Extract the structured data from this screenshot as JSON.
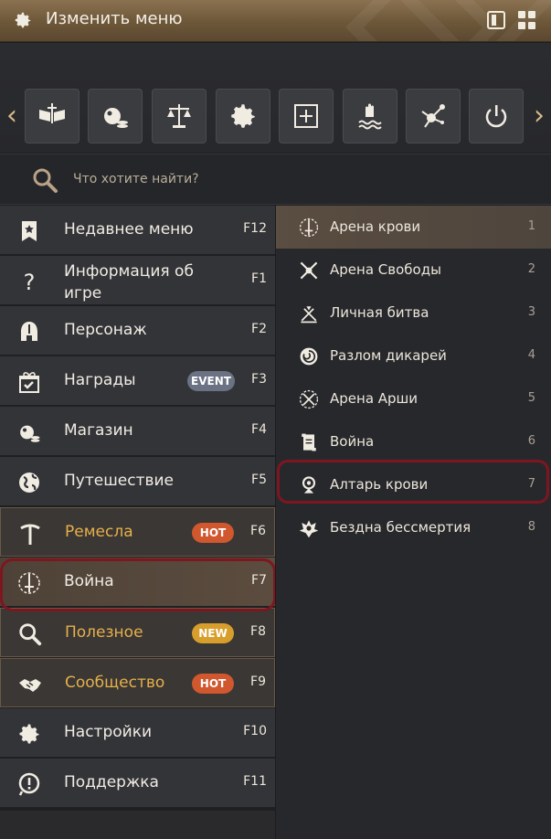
{
  "window": {
    "title": "Изменить меню"
  },
  "search": {
    "placeholder": "Что хотите найти?"
  },
  "menu": [
    {
      "label": "Недавнее меню",
      "key": "F12"
    },
    {
      "label": "Информация об игре",
      "key": "F1"
    },
    {
      "label": "Персонаж",
      "key": "F2"
    },
    {
      "label": "Награды",
      "key": "F3",
      "badge": "EVENT"
    },
    {
      "label": "Магазин",
      "key": "F4"
    },
    {
      "label": "Путешествие",
      "key": "F5"
    },
    {
      "label": "Ремесла",
      "key": "F6",
      "badge": "HOT"
    },
    {
      "label": "Война",
      "key": "F7"
    },
    {
      "label": "Полезное",
      "key": "F8",
      "badge": "NEW"
    },
    {
      "label": "Сообщество",
      "key": "F9",
      "badge": "HOT"
    },
    {
      "label": "Настройки",
      "key": "F10"
    },
    {
      "label": "Поддержка",
      "key": "F11"
    }
  ],
  "submenu": [
    {
      "label": "Арена крови",
      "num": "1"
    },
    {
      "label": "Арена Свободы",
      "num": "2"
    },
    {
      "label": "Личная битва",
      "num": "3"
    },
    {
      "label": "Разлом дикарей",
      "num": "4"
    },
    {
      "label": "Арена Арши",
      "num": "5"
    },
    {
      "label": "Война",
      "num": "6"
    },
    {
      "label": "Алтарь крови",
      "num": "7"
    },
    {
      "label": "Бездна бессмертия",
      "num": "8"
    }
  ],
  "colors": {
    "accent_gold": "#e7b04b",
    "badge_hot": "#d0572e",
    "badge_new": "#d89e2b",
    "badge_event": "#6a7283",
    "highlight": "#7e1620"
  }
}
